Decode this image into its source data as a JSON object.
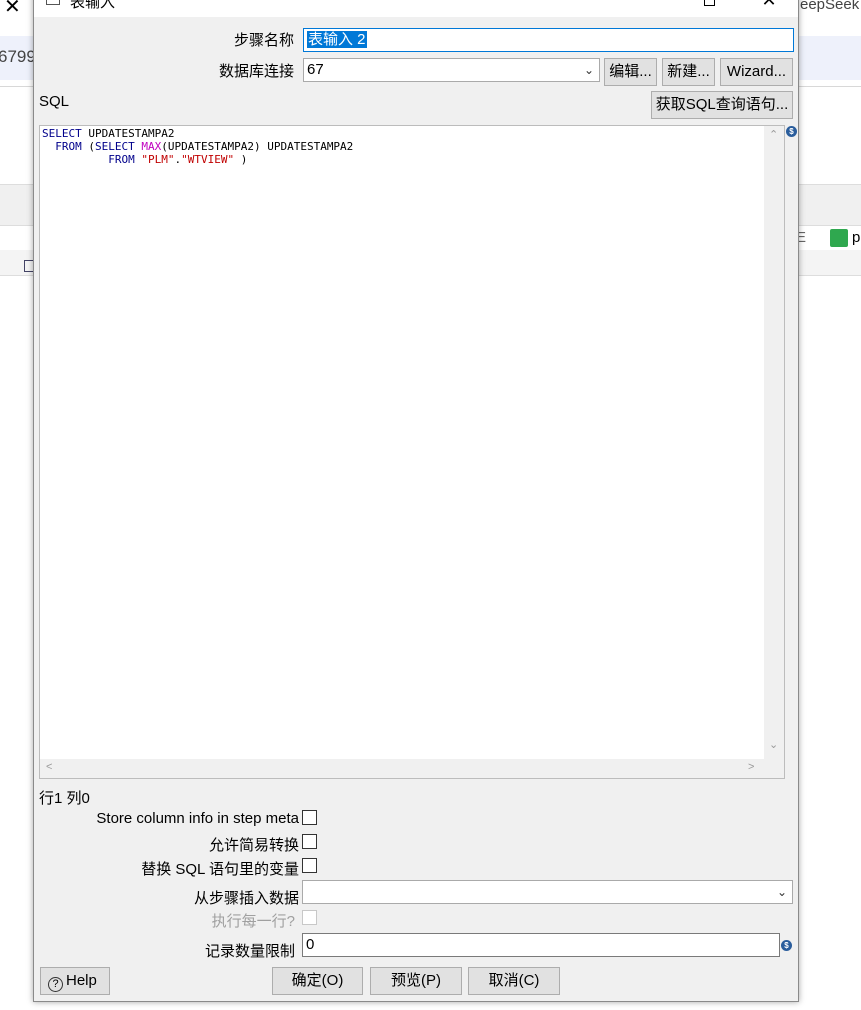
{
  "background": {
    "close_glyph": "✕",
    "left_number": "6799",
    "right_title": "eepSeek",
    "right_label_e": "E",
    "right_label_p": "p"
  },
  "dialog": {
    "title": "表输入",
    "step_name_label": "步骤名称",
    "step_name_value": "表输入 2",
    "db_connection_label": "数据库连接",
    "db_connection_value": "67",
    "edit_button": "编辑...",
    "new_button": "新建...",
    "wizard_button": "Wizard...",
    "sql_label": "SQL",
    "get_sql_button": "获取SQL查询语句...",
    "sql_lines": [
      [
        {
          "t": "SELECT",
          "c": "kw"
        },
        {
          "t": " UPDATESTAMPA2",
          "c": "plain"
        }
      ],
      [
        {
          "t": "  FROM",
          "c": "kw"
        },
        {
          "t": " (",
          "c": "plain"
        },
        {
          "t": "SELECT",
          "c": "kw"
        },
        {
          "t": " ",
          "c": "plain"
        },
        {
          "t": "MAX",
          "c": "fn"
        },
        {
          "t": "(UPDATESTAMPA2) UPDATESTAMPA2",
          "c": "plain"
        }
      ],
      [
        {
          "t": "          FROM",
          "c": "kw"
        },
        {
          "t": " ",
          "c": "plain"
        },
        {
          "t": "\"PLM\"",
          "c": "str"
        },
        {
          "t": ".",
          "c": "plain"
        },
        {
          "t": "\"WTVIEW\"",
          "c": "str"
        },
        {
          "t": " )",
          "c": "plain"
        }
      ]
    ],
    "cursor_position": "行1 列0",
    "store_column_info_label": "Store column info in step meta",
    "lazy_conversion_label": "允许简易转换",
    "replace_variables_label": "替换 SQL 语句里的变量",
    "insert_from_step_label": "从步骤插入数据",
    "insert_from_step_value": "",
    "execute_each_row_label": "执行每一行?",
    "limit_label": "记录数量限制",
    "limit_value": "0",
    "help_button": "Help",
    "ok_button": "确定(O)",
    "preview_button": "预览(P)",
    "cancel_button": "取消(C)"
  },
  "colors": {
    "keyword": "#00008b",
    "function": "#c000c0",
    "string": "#c00000",
    "selection": "#0078d7"
  }
}
